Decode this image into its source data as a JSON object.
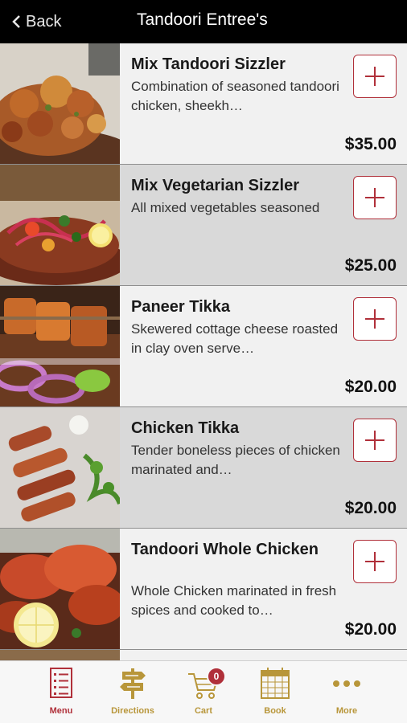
{
  "header": {
    "back_label": "Back",
    "title": "Tandoori Entree's"
  },
  "items": [
    {
      "name": "Mix Tandoori Sizzler",
      "desc": "Combination of seasoned tandoori chicken, sheekh…",
      "price": "$35.00"
    },
    {
      "name": "Mix Vegetarian Sizzler",
      "desc": "All mixed vegetables seasoned",
      "price": "$25.00"
    },
    {
      "name": "Paneer Tikka",
      "desc": "Skewered cottage cheese roasted in clay oven serve…",
      "price": "$20.00"
    },
    {
      "name": "Chicken Tikka",
      "desc": "Tender boneless pieces of chicken marinated and…",
      "price": "$20.00"
    },
    {
      "name": "Tandoori Whole Chicken",
      "desc": "Whole Chicken marinated in fresh spices and cooked to…",
      "price": "$20.00"
    }
  ],
  "tabs": {
    "menu": "Menu",
    "directions": "Directions",
    "cart": "Cart",
    "cart_count": "0",
    "book": "Book",
    "more": "More"
  },
  "colors": {
    "accent_red": "#b0303a",
    "accent_gold": "#b8963a",
    "header_bg": "#000000"
  }
}
